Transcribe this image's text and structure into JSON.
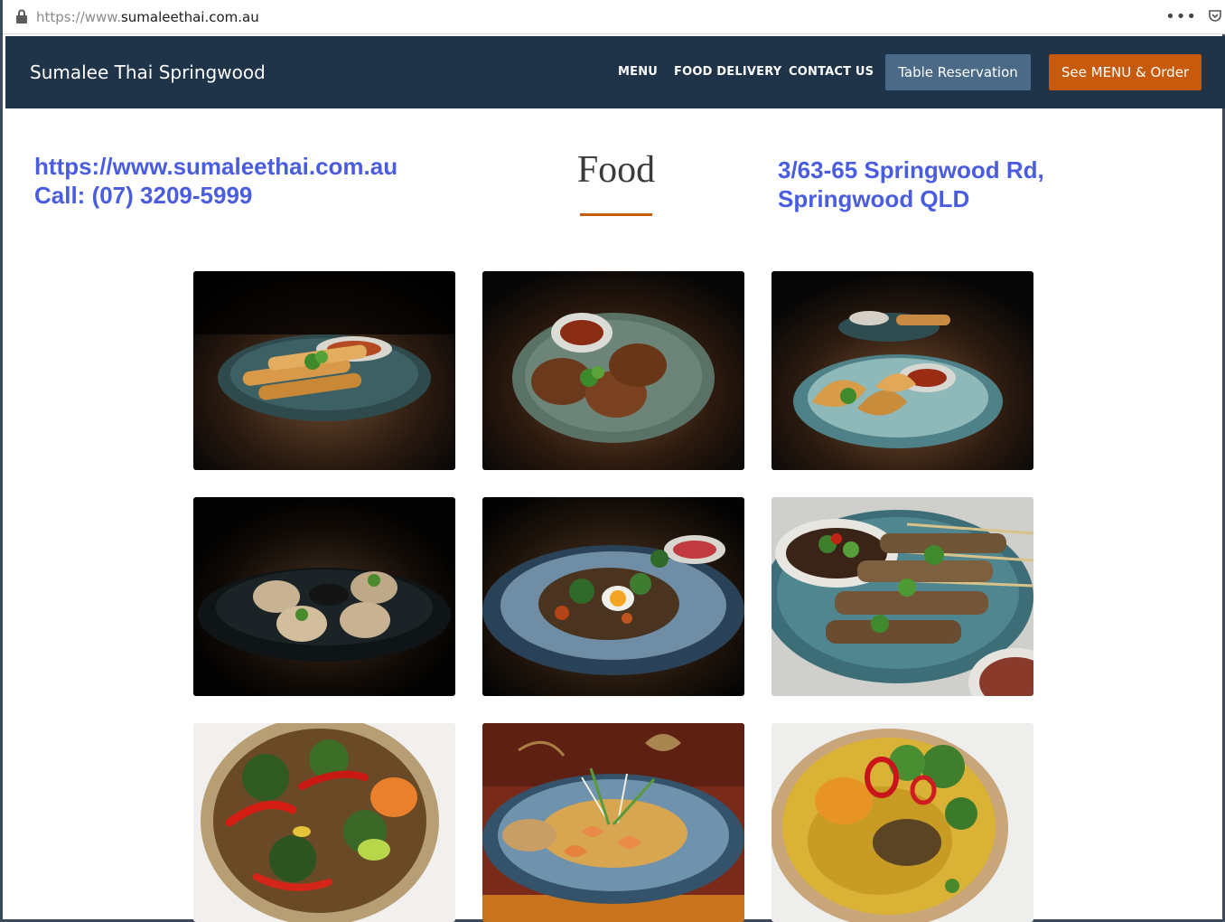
{
  "browser": {
    "url_prefix": "https://www.",
    "url_domain": "sumaleethai.com.au",
    "more_icon": "more-horizontal-icon",
    "pocket_icon": "pocket-icon",
    "lock_icon": "lock-icon"
  },
  "nav": {
    "brand": "Sumalee Thai Springwood",
    "links": [
      "MENU",
      "FOOD DELIVERY",
      "CONTACT US"
    ],
    "reserve_button": "Table Reservation",
    "order_button": "See MENU & Order"
  },
  "header": {
    "website": "https://www.sumaleethai.com.au",
    "call": "Call:  (07) 3209-5999",
    "title": "Food",
    "address_line1": "3/63-65 Springwood Rd,",
    "address_line2": "Springwood QLD"
  },
  "colors": {
    "navbar_bg": "#1f3349",
    "reserve_btn": "#4a6a87",
    "order_btn": "#c75a0c",
    "contact_text": "#4a5de0",
    "title_rule": "#c75a0c"
  },
  "gallery": {
    "photos": [
      "spring-rolls",
      "thai-fish-cakes",
      "curry-puffs",
      "dim-sims",
      "stir-fry-with-egg",
      "chicken-satay-skewers",
      "basil-stir-fry-bowl",
      "pad-thai-prawns",
      "yellow-curry-bowl"
    ]
  }
}
